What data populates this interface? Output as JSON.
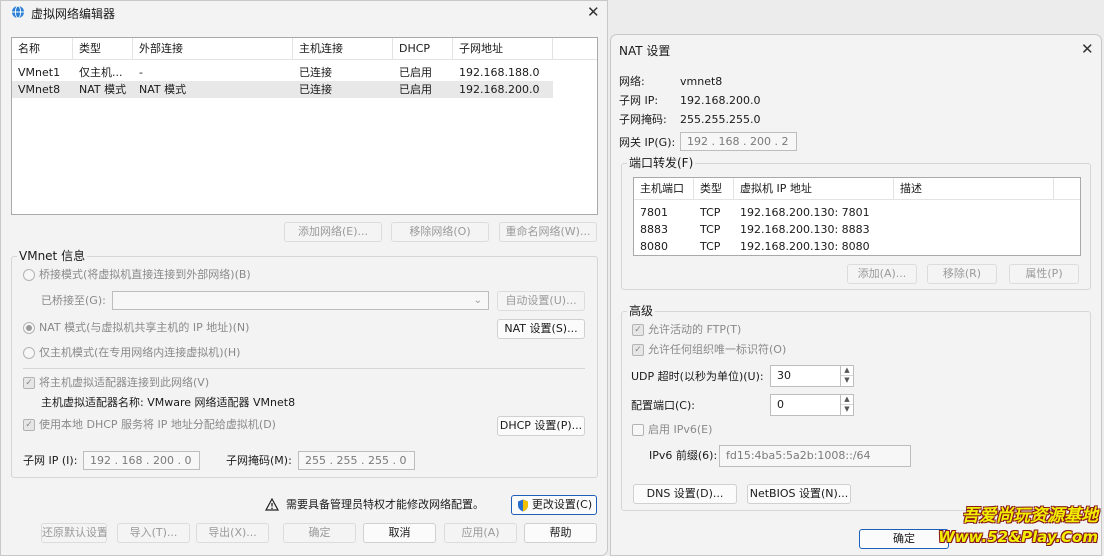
{
  "left_dialog": {
    "title": "虚拟网络编辑器",
    "network_table": {
      "columns": [
        "名称",
        "类型",
        "外部连接",
        "主机连接",
        "DHCP",
        "子网地址"
      ],
      "rows": [
        {
          "name": "VMnet1",
          "type": "仅主机...",
          "external": "-",
          "host": "已连接",
          "dhcp": "已启用",
          "subnet": "192.168.188.0"
        },
        {
          "name": "VMnet8",
          "type": "NAT 模式",
          "external": "NAT 模式",
          "host": "已连接",
          "dhcp": "已启用",
          "subnet": "192.168.200.0"
        }
      ]
    },
    "buttons": {
      "add_network": "添加网络(E)...",
      "remove_network": "移除网络(O)",
      "rename_network": "重命名网络(W)..."
    },
    "vmnet_info": {
      "label": "VMnet 信息",
      "bridged_mode": "桥接模式(将虚拟机直接连接到外部网络)(B)",
      "bridged_to_label": "已桥接至(G):",
      "auto_settings": "自动设置(U)...",
      "nat_mode": "NAT 模式(与虚拟机共享主机的 IP 地址)(N)",
      "nat_settings": "NAT 设置(S)...",
      "host_only_mode": "仅主机模式(在专用网络内连接虚拟机)(H)",
      "connect_adapter": "将主机虚拟适配器连接到此网络(V)",
      "adapter_name": "主机虚拟适配器名称: VMware 网络适配器 VMnet8",
      "use_dhcp": "使用本地 DHCP 服务将 IP 地址分配给虚拟机(D)",
      "dhcp_settings": "DHCP 设置(P)...",
      "subnet_ip_label": "子网 IP (I):",
      "subnet_ip": "192 . 168 . 200 .  0",
      "subnet_mask_label": "子网掩码(M):",
      "subnet_mask": "255 . 255 . 255 .  0"
    },
    "admin_notice": "需要具备管理员特权才能修改网络配置。",
    "change_settings": "更改设置(C)",
    "footer": {
      "restore": "还原默认设置(R)",
      "import": "导入(T)...",
      "export": "导出(X)...",
      "ok": "确定",
      "cancel": "取消",
      "apply": "应用(A)",
      "help": "帮助"
    }
  },
  "nat_dialog": {
    "title": "NAT 设置",
    "network_label": "网络:",
    "network_value": "vmnet8",
    "subnet_ip_label": "子网 IP:",
    "subnet_ip_value": "192.168.200.0",
    "subnet_mask_label": "子网掩码:",
    "subnet_mask_value": "255.255.255.0",
    "gateway_label": "网关 IP(G):",
    "gateway_value": "192 . 168 . 200 .  2",
    "port_forwarding": {
      "label": "端口转发(F)",
      "columns": [
        "主机端口",
        "类型",
        "虚拟机 IP 地址",
        "描述"
      ],
      "rows": [
        {
          "port": "7801",
          "type": "TCP",
          "vm_ip": "192.168.200.130: 7801",
          "desc": ""
        },
        {
          "port": "8883",
          "type": "TCP",
          "vm_ip": "192.168.200.130: 8883",
          "desc": ""
        },
        {
          "port": "8080",
          "type": "TCP",
          "vm_ip": "192.168.200.130: 8080",
          "desc": ""
        }
      ],
      "add": "添加(A)...",
      "remove": "移除(R)",
      "properties": "属性(P)"
    },
    "advanced": {
      "label": "高级",
      "allow_ftp": "允许活动的 FTP(T)",
      "allow_oui": "允许任何组织唯一标识符(O)",
      "udp_timeout_label": "UDP 超时(以秒为单位)(U):",
      "udp_timeout_value": "30",
      "config_port_label": "配置端口(C):",
      "config_port_value": "0",
      "enable_ipv6": "启用 IPv6(E)",
      "ipv6_prefix_label": "IPv6 前缀(6):",
      "ipv6_prefix_value": "fd15:4ba5:5a2b:1008::/64"
    },
    "dns_settings": "DNS 设置(D)...",
    "netbios_settings": "NetBIOS 设置(N)...",
    "ok": "确定"
  },
  "watermark": {
    "line1": "吾爱尚玩资源基地",
    "line2": "Www.52&Play.Com"
  },
  "colors": {
    "window_bg": "#f3f3f3",
    "accent": "#1f5fb8",
    "selected_row": "#e8e8e8",
    "watermark": "#f2f000"
  }
}
